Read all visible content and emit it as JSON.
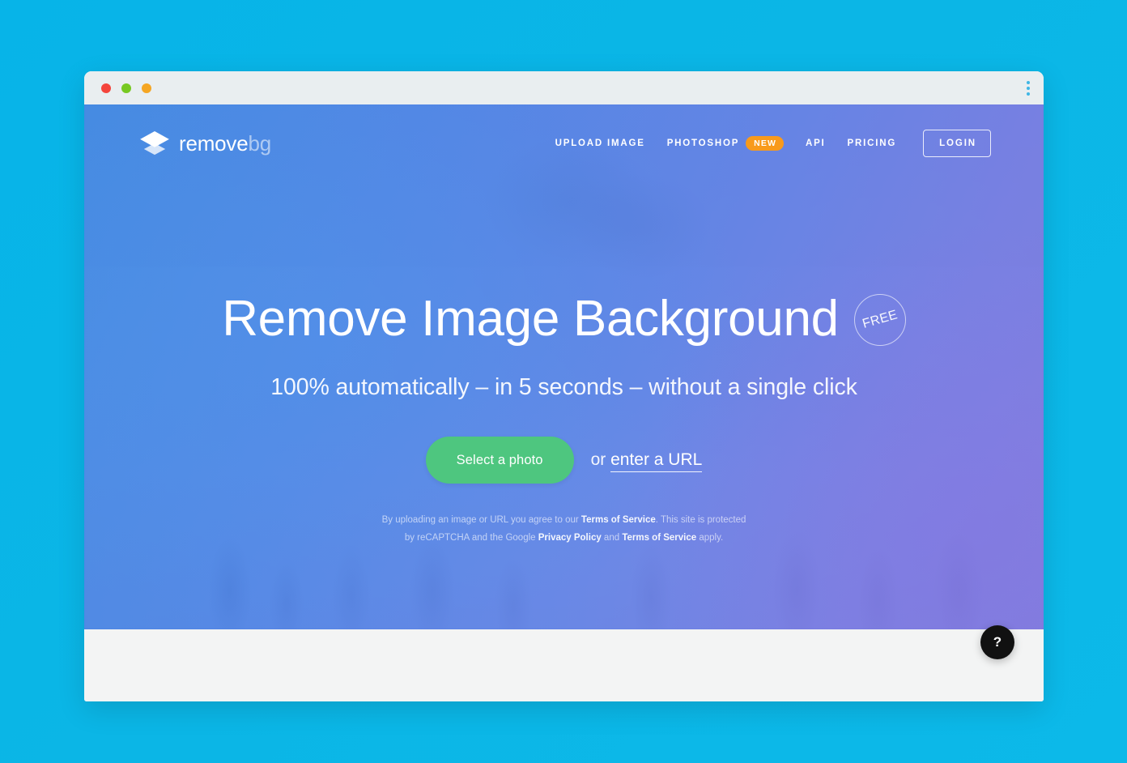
{
  "window": {
    "traffic_lights": [
      "close",
      "minimize",
      "maximize"
    ],
    "menu_icon": "kebab-menu-icon"
  },
  "nav": {
    "logo": {
      "icon": "layers-icon",
      "text_primary": "remove",
      "text_secondary": "bg"
    },
    "links": [
      {
        "label": "UPLOAD IMAGE",
        "badge": null
      },
      {
        "label": "PHOTOSHOP",
        "badge": "NEW"
      },
      {
        "label": "API",
        "badge": null
      },
      {
        "label": "PRICING",
        "badge": null
      }
    ],
    "login_label": "LOGIN"
  },
  "hero": {
    "headline": "Remove Image Background",
    "free_badge": "FREE",
    "subheadline": "100% automatically – in 5 seconds – without a single click",
    "cta_button": "Select a photo",
    "url_prefix": "or ",
    "url_link": "enter a URL",
    "fineprint": {
      "line1_part1": "By uploading an image or URL you agree to our ",
      "line1_link": "Terms of Service",
      "line1_part2": ". This site is protected",
      "line2_part1": "by reCAPTCHA and the Google ",
      "line2_link1": "Privacy Policy",
      "line2_part2": " and ",
      "line2_link2": "Terms of Service",
      "line2_part3": " apply."
    }
  },
  "help": {
    "label": "?"
  },
  "colors": {
    "page_background": "#0bb6e6",
    "titlebar": "#e9eef0",
    "hero_blue": "#5a8ce8",
    "hero_purple": "#8072de",
    "cta_green": "#4ec67f",
    "badge_orange": "#f89a1c",
    "footer_gray": "#f3f4f4",
    "help_black": "#111111",
    "traffic_red": "#f4453c",
    "traffic_yellow": "#f5a623",
    "traffic_green": "#77c922"
  }
}
